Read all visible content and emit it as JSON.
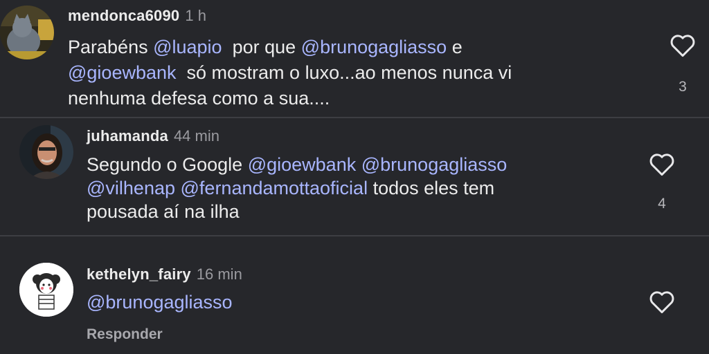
{
  "colors": {
    "background": "#26272b",
    "text": "#ececec",
    "mention": "#a9b6ff",
    "muted": "#9b9ba0",
    "divider": "#3d3e43"
  },
  "comments": [
    {
      "username": "mendonca6090",
      "time": "1 h",
      "avatar_icon": "cat-avatar",
      "lines": [
        [
          {
            "t": "Parabéns ",
            "m": false
          },
          {
            "t": "@luapio",
            "m": true
          },
          {
            "t": "  por que ",
            "m": false
          },
          {
            "t": "@brunogagliasso",
            "m": true
          },
          {
            "t": " e",
            "m": false
          }
        ],
        [
          {
            "t": "@gioewbank",
            "m": true
          },
          {
            "t": "  só mostram o luxo...ao menos nunca vi",
            "m": false
          }
        ],
        [
          {
            "t": "nenhuma defesa como a sua....",
            "m": false
          }
        ]
      ],
      "like_icon": "heart-outline-icon",
      "likes": "3"
    },
    {
      "username": "juhamanda",
      "time": "44 min",
      "avatar_icon": "woman-avatar",
      "lines": [
        [
          {
            "t": "Segundo o Google ",
            "m": false
          },
          {
            "t": "@gioewbank",
            "m": true
          },
          {
            "t": " ",
            "m": false
          },
          {
            "t": "@brunogagliasso",
            "m": true
          }
        ],
        [
          {
            "t": "@vilhenap",
            "m": true
          },
          {
            "t": " ",
            "m": false
          },
          {
            "t": "@fernandamottaoficial",
            "m": true
          },
          {
            "t": " todos eles tem",
            "m": false
          }
        ],
        [
          {
            "t": "pousada aí na ilha",
            "m": false
          }
        ]
      ],
      "like_icon": "heart-outline-icon",
      "likes": "4"
    },
    {
      "username": "kethelyn_fairy",
      "time": "16 min",
      "avatar_icon": "cartoon-girl-avatar",
      "lines": [
        [
          {
            "t": "@brunogagliasso",
            "m": true
          }
        ]
      ],
      "like_icon": "heart-outline-icon",
      "likes": "",
      "reply_label": "Responder"
    }
  ]
}
